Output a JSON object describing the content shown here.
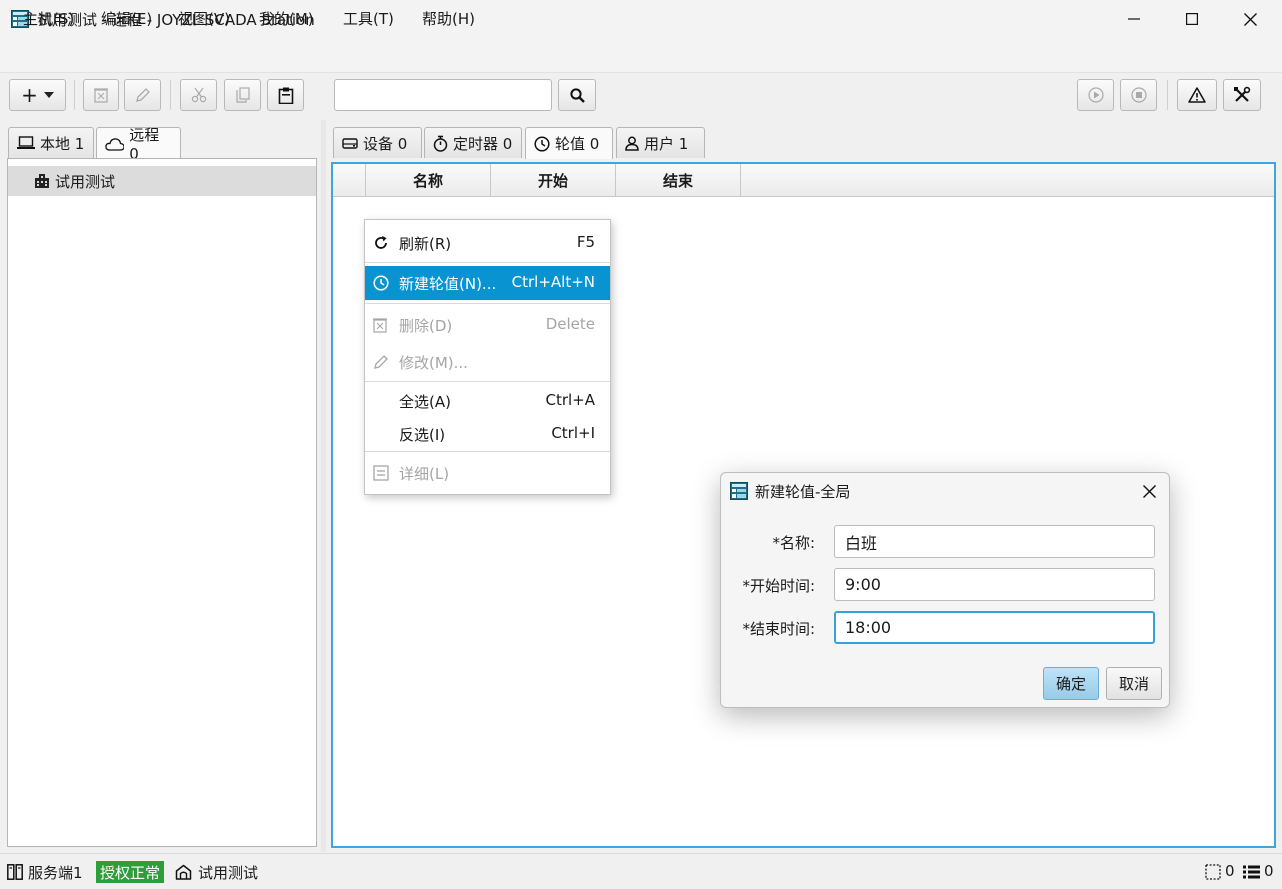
{
  "window": {
    "title": "试用测试 - 远程 - JOYZL SCADA Station"
  },
  "menubar": [
    "主机(S)",
    "编辑(E)",
    "视图(V)",
    "我的(M)",
    "工具(T)",
    "帮助(H)"
  ],
  "toolbar": {
    "add_label": "+",
    "search_placeholder": ""
  },
  "left_tabs": [
    {
      "label": "本地 1",
      "icon": "laptop-icon"
    },
    {
      "label": "远程 0",
      "icon": "cloud-icon",
      "active": true
    }
  ],
  "tree": {
    "item": "试用测试",
    "icon": "building-icon"
  },
  "right_tabs": [
    {
      "label": "设备 0",
      "icon": "device-icon"
    },
    {
      "label": "定时器 0",
      "icon": "stopwatch-icon"
    },
    {
      "label": "轮值 0",
      "icon": "clock-icon",
      "active": true
    },
    {
      "label": "用户 1",
      "icon": "user-icon"
    }
  ],
  "table": {
    "columns": [
      "名称",
      "开始",
      "结束"
    ]
  },
  "context_menu": {
    "items": [
      {
        "label": "刷新(R)",
        "shortcut": "F5",
        "icon": "refresh-icon",
        "state": "normal"
      },
      {
        "label": "新建轮值(N)...",
        "shortcut": "Ctrl+Alt+N",
        "icon": "clock-icon",
        "state": "highlight"
      },
      {
        "label": "删除(D)",
        "shortcut": "Delete",
        "icon": "delete-icon",
        "state": "disabled"
      },
      {
        "label": "修改(M)...",
        "shortcut": "",
        "icon": "pencil-icon",
        "state": "disabled"
      },
      {
        "label": "全选(A)",
        "shortcut": "Ctrl+A",
        "icon": "",
        "state": "normal"
      },
      {
        "label": "反选(I)",
        "shortcut": "Ctrl+I",
        "icon": "",
        "state": "normal"
      },
      {
        "label": "详细(L)",
        "shortcut": "",
        "icon": "details-icon",
        "state": "disabled"
      }
    ]
  },
  "dialog": {
    "title": "新建轮值-全局",
    "fields": [
      {
        "label": "*名称:",
        "value": "白班"
      },
      {
        "label": "*开始时间:",
        "value": "9:00"
      },
      {
        "label": "*结束时间:",
        "value": "18:00"
      }
    ],
    "ok_label": "确定",
    "cancel_label": "取消"
  },
  "statusbar": {
    "server": "服务端1",
    "license": "授权正常",
    "project": "试用测试",
    "selection_count": "0",
    "list_count": "0"
  },
  "colors": {
    "accent": "#0a93d1",
    "focus_border": "#38a1da",
    "license_badge": "#2e9d3a"
  }
}
